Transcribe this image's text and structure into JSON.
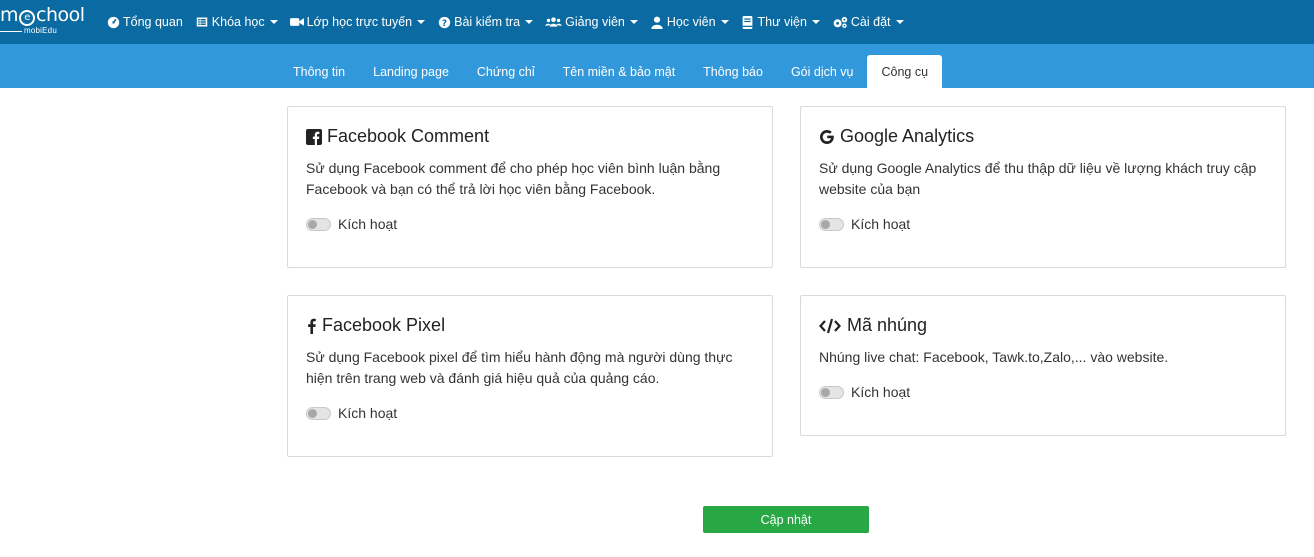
{
  "logo": {
    "brand": "mSchool",
    "sub": "mobiEdu"
  },
  "nav": {
    "items": [
      {
        "label": "Tổng quan",
        "icon": "dashboard-icon",
        "dropdown": false
      },
      {
        "label": "Khóa học",
        "icon": "list-icon",
        "dropdown": true
      },
      {
        "label": "Lớp học trực tuyến",
        "icon": "video-camera-icon",
        "dropdown": true
      },
      {
        "label": "Bài kiểm tra",
        "icon": "question-circle-icon",
        "dropdown": true
      },
      {
        "label": "Giảng viên",
        "icon": "users-icon",
        "dropdown": true
      },
      {
        "label": "Học viên",
        "icon": "user-icon",
        "dropdown": true
      },
      {
        "label": "Thư viện",
        "icon": "book-icon",
        "dropdown": true
      },
      {
        "label": "Cài đặt",
        "icon": "gears-icon",
        "dropdown": true
      }
    ]
  },
  "tabs": {
    "items": [
      {
        "label": "Thông tin"
      },
      {
        "label": "Landing page"
      },
      {
        "label": "Chứng chỉ"
      },
      {
        "label": "Tên miền & bảo mật"
      },
      {
        "label": "Thông báo"
      },
      {
        "label": "Gói dịch vụ"
      },
      {
        "label": "Công cụ"
      }
    ],
    "active": "Công cụ"
  },
  "cards": {
    "fb_comment": {
      "title": "Facebook Comment",
      "desc_line1": "Sử dụng Facebook comment để cho phép học viên bình luận bằng",
      "desc_line2": "Facebook và bạn có thể trả lời học viên bằng Facebook.",
      "toggle_label": "Kích hoạt",
      "enabled": false
    },
    "google_analytics": {
      "title": "Google Analytics",
      "desc_line1": "Sử dụng Google Analytics để thu thập dữ liệu về lượng khách truy cập",
      "desc_line2": "website của bạn",
      "toggle_label": "Kích hoạt",
      "enabled": false
    },
    "fb_pixel": {
      "title": "Facebook Pixel",
      "desc_line1": "Sử dụng Facebook pixel để tìm hiểu hành động mà người dùng thực",
      "desc_line2": "hiện trên trang web và đánh giá hiệu quả của quảng cáo.",
      "toggle_label": "Kích hoạt",
      "enabled": false
    },
    "embed_code": {
      "title": "Mã nhúng",
      "desc_line1": "Nhúng live chat: Facebook, Tawk.to,Zalo,... vào website.",
      "toggle_label": "Kích hoạt",
      "enabled": false
    }
  },
  "update_button": {
    "label": "Cập nhật"
  },
  "colors": {
    "topbar": "#0b6aa2",
    "subbar": "#3298dc",
    "update_button": "#28a745"
  }
}
